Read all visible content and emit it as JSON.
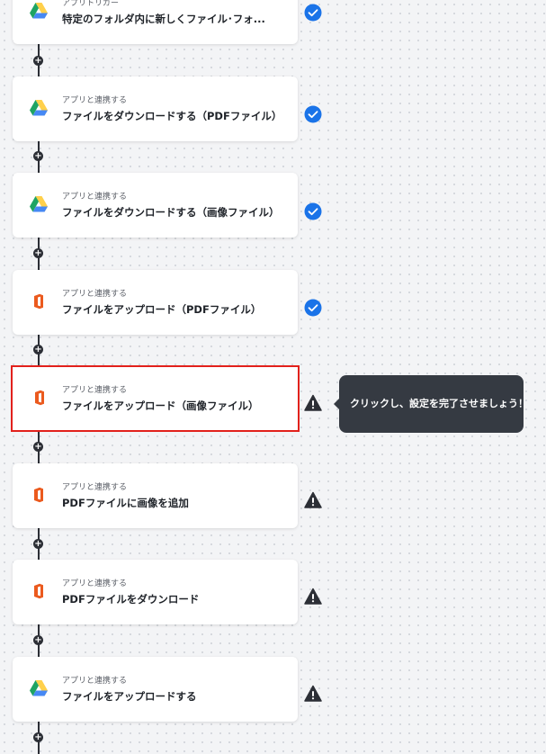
{
  "flow": {
    "steps": [
      {
        "kind": "アプリトリガー",
        "title": "特定のフォルダ内に新しくファイル･フォ...",
        "app": "google-drive",
        "status": "complete"
      },
      {
        "kind": "アプリと連携する",
        "title": "ファイルをダウンロードする（PDFファイル）",
        "app": "google-drive",
        "status": "complete"
      },
      {
        "kind": "アプリと連携する",
        "title": "ファイルをダウンロードする（画像ファイル）",
        "app": "google-drive",
        "status": "complete"
      },
      {
        "kind": "アプリと連携する",
        "title": "ファイルをアップロード（PDFファイル）",
        "app": "office-pdf-app",
        "status": "complete"
      },
      {
        "kind": "アプリと連携する",
        "title": "ファイルをアップロード（画像ファイル）",
        "app": "office-pdf-app",
        "status": "incomplete",
        "selected": true
      },
      {
        "kind": "アプリと連携する",
        "title": "PDFファイルに画像を追加",
        "app": "office-pdf-app",
        "status": "incomplete"
      },
      {
        "kind": "アプリと連携する",
        "title": "PDFファイルをダウンロード",
        "app": "office-pdf-app",
        "status": "incomplete"
      },
      {
        "kind": "アプリと連携する",
        "title": "ファイルをアップロードする",
        "app": "google-drive",
        "status": "incomplete"
      }
    ],
    "tooltip": "クリックし、設定を完了させましょう！"
  },
  "colors": {
    "complete": "#1a73e8",
    "warning": "#2c2f36",
    "selected_border": "#e2211c",
    "office_orange": "#eb5a1e",
    "drive_green": "#1fa463",
    "drive_yellow": "#ffd04b",
    "drive_blue": "#4688f4"
  },
  "icons": {
    "complete": "check-circle-icon",
    "incomplete": "warning-icon",
    "google-drive": "google-drive-icon",
    "office-pdf-app": "office-app-icon",
    "add": "plus-circle-icon"
  }
}
